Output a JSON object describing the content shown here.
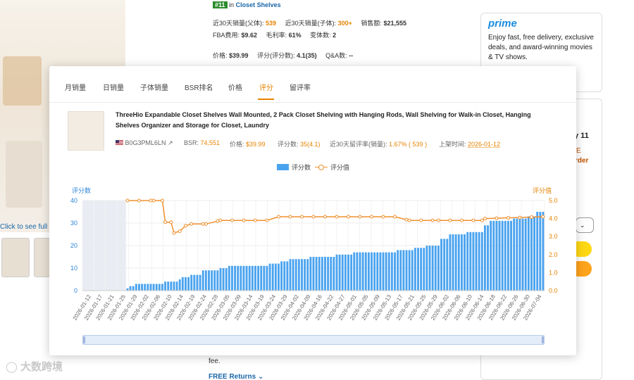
{
  "background": {
    "rank": {
      "badge": "#11",
      "in": "in",
      "category": "Closet Shelves"
    },
    "row2": {
      "parent_label": "近30天销量(父体):",
      "parent_value": "539",
      "child_label": "近30天销量(子体):",
      "child_value": "300+",
      "sales_label": "销售额:",
      "sales_value": "$21,555"
    },
    "row3": {
      "fba_label": "FBA费用:",
      "fba_value": "$9.62",
      "margin_label": "毛利率:",
      "margin_value": "61%",
      "variants_label": "变体数:",
      "variants_value": "2"
    },
    "row4": {
      "price_label": "价格:",
      "price_value": "$39.99",
      "rating_label": "评分(评分数):",
      "rating_value": "4.1(35)",
      "qa_label": "Q&A数:",
      "qa_value": "--"
    },
    "left_link": "Click to see full",
    "prime": {
      "logo": "prime",
      "text": "Enjoy fast, free delivery, exclusive deals, and award-winning movies & TV shows."
    },
    "right_frag": {
      "date": "y 11",
      "e": "E",
      "order": "rder"
    },
    "bottom": {
      "fee": "fee.",
      "returns": "FREE Returns"
    },
    "watermark": "大数跨境"
  },
  "popup": {
    "tabs": [
      "月销量",
      "日销量",
      "子体销量",
      "BSR排名",
      "价格",
      "评分",
      "留评率"
    ],
    "active_tab": "评分",
    "product": {
      "title": "ThreeHio Expandable Closet Shelves Wall Mounted, 2 Pack Closet Shelving with Hanging Rods, Wall Shelving for Walk-in Closet, Hanging Shelves Organizer and Storage for Closet, Laundry",
      "asin": "B0G3PML6LN",
      "bsr_label": "BSR:",
      "bsr_value": "74,551",
      "price_label": "价格:",
      "price_value": "$39.99",
      "rating_label": "评分数:",
      "rating_value": "35(4.1)",
      "review_rate_label": "近30天留评率(销量):",
      "review_rate_value": "1.67% ( 539 )",
      "launch_label": "上架时间:",
      "launch_value": "2026-01-12"
    }
  },
  "colors": {
    "bar": "#4aa3ef",
    "line": "#f0902e",
    "accent": "#e68300",
    "link": "#1a66a8"
  },
  "chart_data": {
    "type": "bar+line",
    "legend_position": "top-center",
    "grid": true,
    "series": [
      {
        "name": "评分数",
        "type": "bar",
        "axis": "left"
      },
      {
        "name": "评分值",
        "type": "line",
        "axis": "right"
      }
    ],
    "yleft": {
      "label": "评分数",
      "lim": [
        0,
        40
      ],
      "ticks": [
        0,
        10,
        20,
        30,
        40
      ]
    },
    "yright": {
      "label": "评分值",
      "lim": [
        0.0,
        5.0
      ],
      "ticks": [
        "0.0",
        "1.0",
        "2.0",
        "3.0",
        "4.0",
        "5.0"
      ]
    },
    "x_tick_labels": [
      "2026-01-12",
      "2026-01-17",
      "2026-01-21",
      "2026-01-25",
      "2026-01-29",
      "2026-02-02",
      "2026-02-06",
      "2026-02-10",
      "2026-02-14",
      "2026-02-19",
      "2026-02-24",
      "2026-02-28",
      "2026-03-05",
      "2026-03-09",
      "2026-03-14",
      "2026-03-19",
      "2026-03-24",
      "2026-03-29",
      "2026-04-02",
      "2026-04-09",
      "2026-04-16",
      "2026-04-22",
      "2026-04-27",
      "2026-05-01",
      "2026-05-05",
      "2026-05-09",
      "2026-05-13",
      "2026-05-17",
      "2026-05-21",
      "2026-05-25",
      "2026-05-29",
      "2026-06-02",
      "2026-06-06",
      "2026-06-10",
      "2026-06-14",
      "2026-06-18",
      "2026-06-22",
      "2026-06-26",
      "2026-06-30",
      "2026-07-04"
    ],
    "n_points": 159,
    "rating_count_steps": [
      {
        "from": 0,
        "to": 14,
        "value": 0
      },
      {
        "from": 15,
        "to": 15,
        "value": 1
      },
      {
        "from": 16,
        "to": 17,
        "value": 2
      },
      {
        "from": 18,
        "to": 27,
        "value": 3
      },
      {
        "from": 28,
        "to": 32,
        "value": 4
      },
      {
        "from": 33,
        "to": 33,
        "value": 5
      },
      {
        "from": 34,
        "to": 36,
        "value": 6
      },
      {
        "from": 37,
        "to": 40,
        "value": 7
      },
      {
        "from": 41,
        "to": 46,
        "value": 9
      },
      {
        "from": 47,
        "to": 49,
        "value": 10
      },
      {
        "from": 50,
        "to": 63,
        "value": 11
      },
      {
        "from": 64,
        "to": 67,
        "value": 12
      },
      {
        "from": 68,
        "to": 70,
        "value": 13
      },
      {
        "from": 71,
        "to": 77,
        "value": 14
      },
      {
        "from": 78,
        "to": 86,
        "value": 15
      },
      {
        "from": 87,
        "to": 92,
        "value": 16
      },
      {
        "from": 93,
        "to": 107,
        "value": 17
      },
      {
        "from": 108,
        "to": 113,
        "value": 18
      },
      {
        "from": 114,
        "to": 117,
        "value": 19
      },
      {
        "from": 118,
        "to": 122,
        "value": 20
      },
      {
        "from": 123,
        "to": 125,
        "value": 23
      },
      {
        "from": 126,
        "to": 131,
        "value": 25
      },
      {
        "from": 132,
        "to": 137,
        "value": 26
      },
      {
        "from": 138,
        "to": 139,
        "value": 29
      },
      {
        "from": 140,
        "to": 147,
        "value": 31
      },
      {
        "from": 148,
        "to": 152,
        "value": 32
      },
      {
        "from": 153,
        "to": 155,
        "value": 33
      },
      {
        "from": 156,
        "to": 158,
        "value": 35
      }
    ],
    "rating_value_points": [
      {
        "i": 15,
        "v": 5.0
      },
      {
        "i": 24,
        "v": 5.0
      },
      {
        "i": 27,
        "v": 5.0
      },
      {
        "i": 28,
        "v": 3.8
      },
      {
        "i": 30,
        "v": 3.8
      },
      {
        "i": 31,
        "v": 3.2
      },
      {
        "i": 33,
        "v": 3.3
      },
      {
        "i": 35,
        "v": 3.6
      },
      {
        "i": 37,
        "v": 3.7
      },
      {
        "i": 42,
        "v": 3.7
      },
      {
        "i": 47,
        "v": 3.9
      },
      {
        "i": 63,
        "v": 3.9
      },
      {
        "i": 67,
        "v": 4.1
      },
      {
        "i": 107,
        "v": 4.1
      },
      {
        "i": 112,
        "v": 3.9
      },
      {
        "i": 122,
        "v": 3.9
      },
      {
        "i": 137,
        "v": 3.9
      },
      {
        "i": 138,
        "v": 4.0
      },
      {
        "i": 158,
        "v": 4.1
      }
    ],
    "shaded_region": {
      "from_index": 0,
      "to_index": 14
    }
  }
}
